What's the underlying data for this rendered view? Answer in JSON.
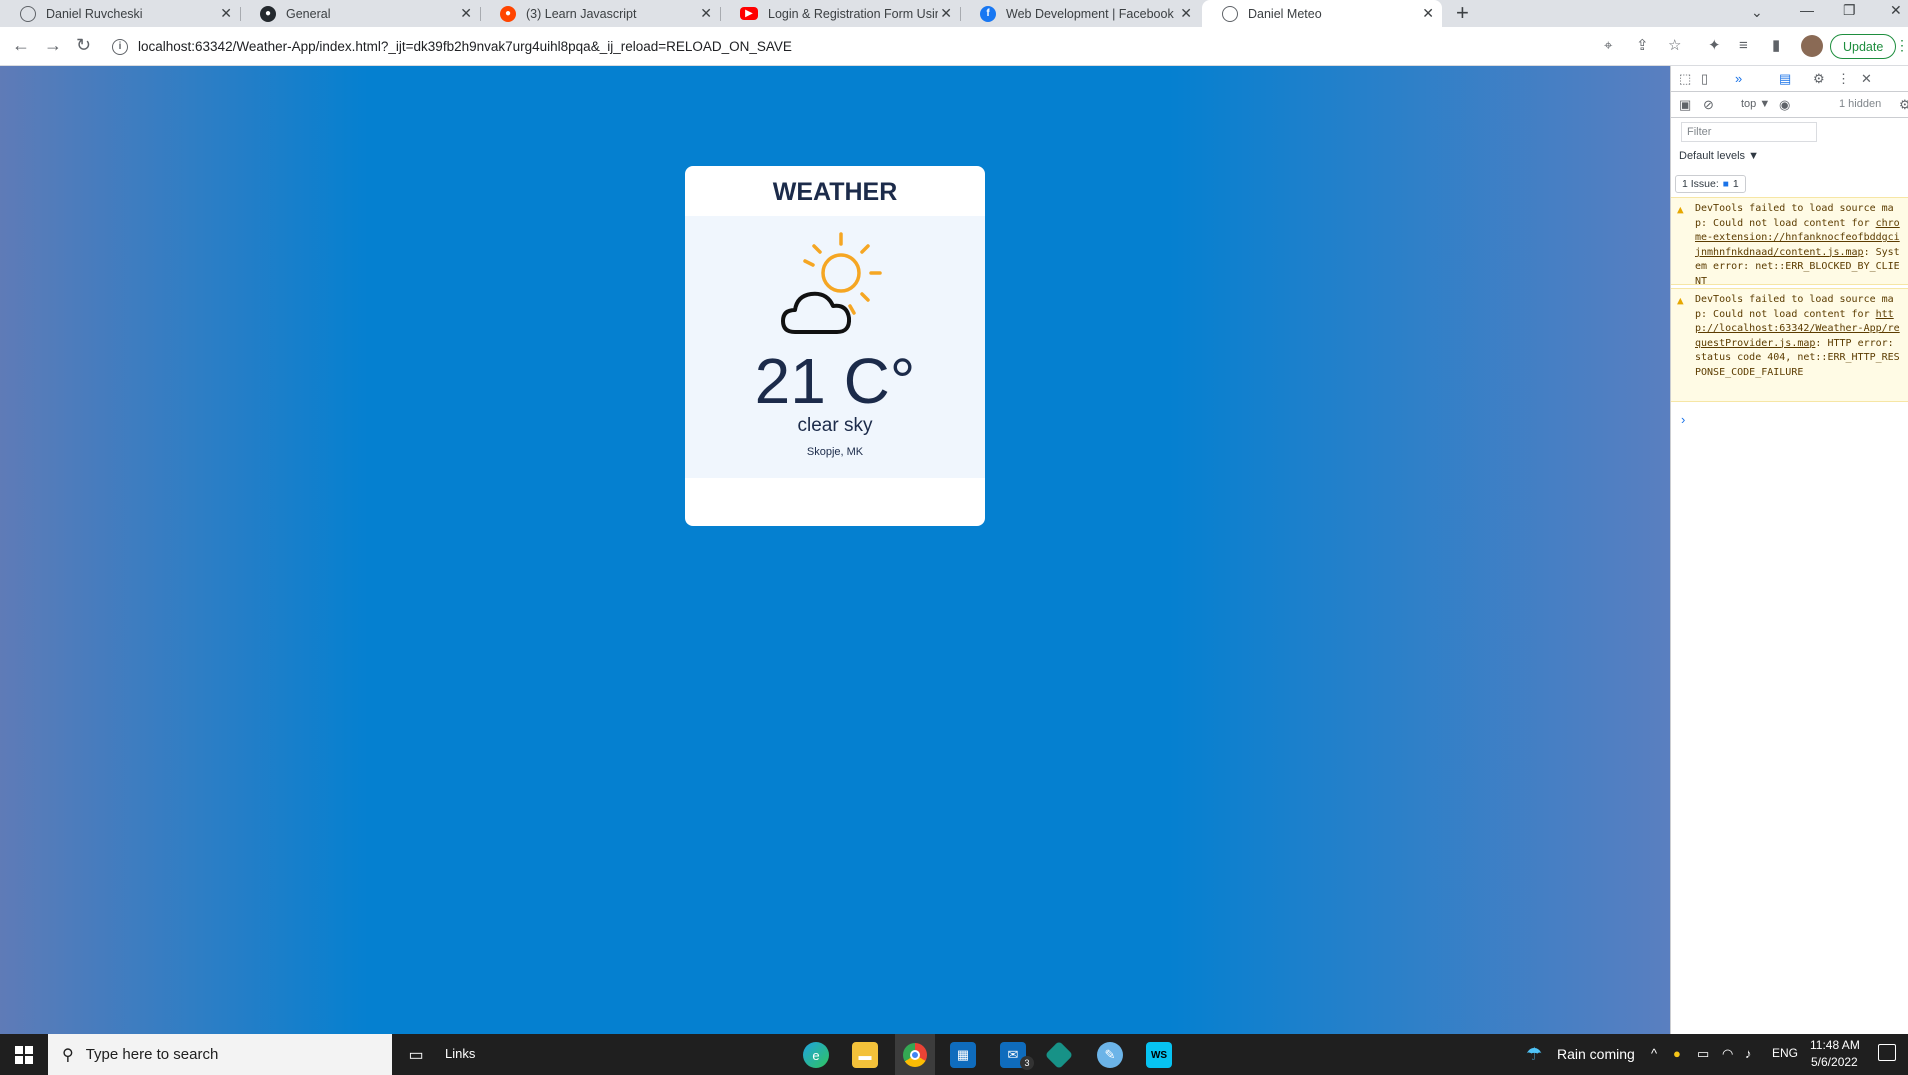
{
  "browser": {
    "tabs": [
      {
        "title": "Daniel Ruvcheski",
        "icon": "globe-icon"
      },
      {
        "title": "General",
        "icon": "github-icon"
      },
      {
        "title": "(3) Learn Javascript",
        "icon": "reddit-icon"
      },
      {
        "title": "Login & Registration Form Using",
        "icon": "youtube-icon"
      },
      {
        "title": "Web Development | Facebook",
        "icon": "facebook-icon"
      },
      {
        "title": "Daniel Meteo",
        "icon": "globe-icon",
        "active": true
      }
    ],
    "url": "localhost:63342/Weather-App/index.html?_ijt=dk39fb2h9nvak7urg4uihl8pqa&_ij_reload=RELOAD_ON_SAVE",
    "update_label": "Update"
  },
  "weather": {
    "heading": "WEATHER",
    "temperature": "21 C°",
    "description": "clear sky",
    "location": "Skopje, MK",
    "icon": "partly-cloudy-icon"
  },
  "devtools": {
    "context": "top",
    "hidden_label": "1 hidden",
    "filter_placeholder": "Filter",
    "levels_label": "Default levels ▼",
    "issue_label": "1 Issue:",
    "issue_count": "1",
    "messages": [
      {
        "pre": "DevTools failed to load source map: Could not load content for ",
        "link": "chrome-extension://hnfanknocfeofbddgcijnmhnfnkdnaad/content.js.map",
        "post": ": System error: net::ERR_BLOCKED_BY_CLIENT"
      },
      {
        "pre": "DevTools failed to load source map: Could not load content for ",
        "link": "http://localhost:63342/Weather-App/requestProvider.js.map",
        "post": ": HTTP error: status code 404, net::ERR_HTTP_RESPONSE_CODE_FAILURE"
      }
    ]
  },
  "taskbar": {
    "search_placeholder": "Type here to search",
    "links_label": "Links",
    "weather_status": "Rain coming",
    "language": "ENG",
    "time": "11:48 AM",
    "date": "5/6/2022",
    "mail_badge": "3"
  },
  "colors": {
    "page_background": "#0580d0",
    "card_text": "#1c2b4a",
    "sun": "#f5a623",
    "update_green": "#1e8e3e"
  }
}
